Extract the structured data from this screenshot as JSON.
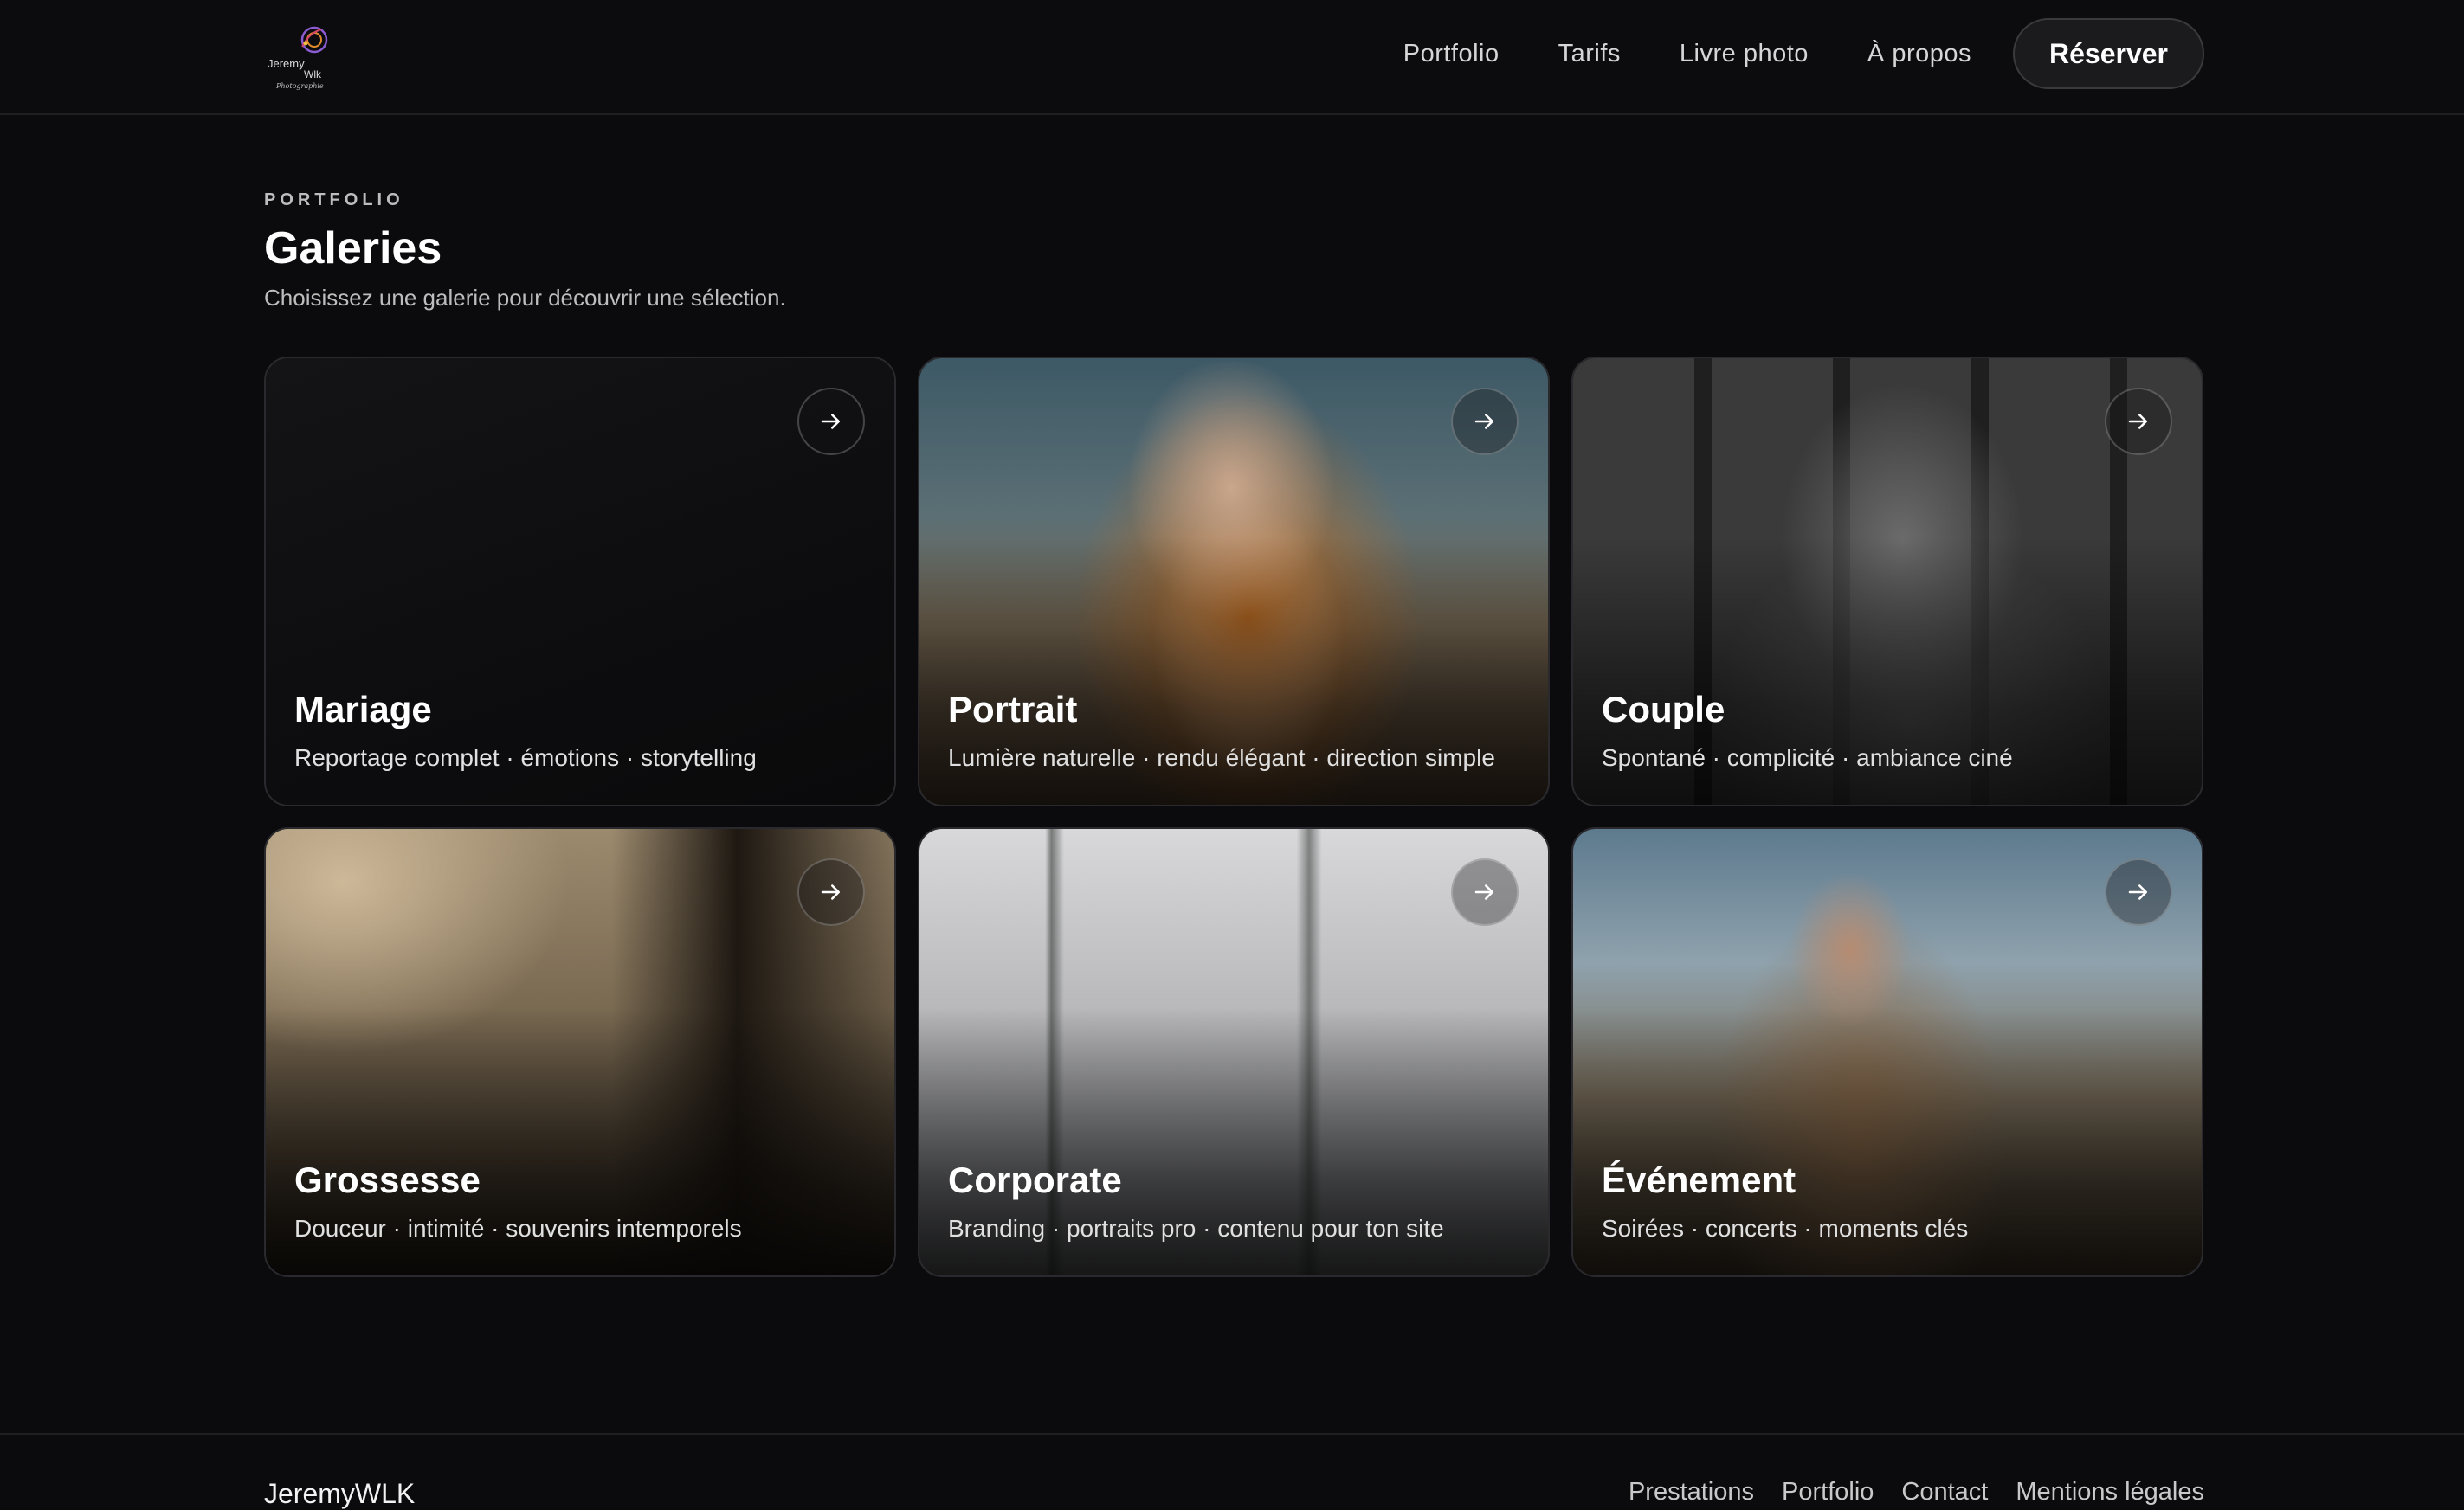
{
  "brand": {
    "logo_name": "JeremyWLK",
    "logo_lines": [
      "Jeremy",
      "Wlk",
      "Photographie"
    ]
  },
  "nav": {
    "items": [
      "Portfolio",
      "Tarifs",
      "Livre photo",
      "À propos"
    ],
    "cta": "Réserver"
  },
  "section": {
    "eyebrow": "PORTFOLIO",
    "title": "Galeries",
    "subtitle": "Choisissez une galerie pour découvrir une sélection."
  },
  "galleries": [
    {
      "title": "Mariage",
      "desc": "Reportage complet · émotions · storytelling"
    },
    {
      "title": "Portrait",
      "desc": "Lumière naturelle · rendu élégant · direction simple"
    },
    {
      "title": "Couple",
      "desc": "Spontané · complicité · ambiance ciné"
    },
    {
      "title": "Grossesse",
      "desc": "Douceur · intimité · souvenirs intemporels"
    },
    {
      "title": "Corporate",
      "desc": "Branding · portraits pro · contenu pour ton site"
    },
    {
      "title": "Événement",
      "desc": "Soirées · concerts · moments clés"
    }
  ],
  "footer": {
    "brand": "JeremyWLK",
    "links": [
      "Prestations",
      "Portfolio",
      "Contact",
      "Mentions légales"
    ]
  },
  "colors": {
    "background": "#0b0b0d",
    "card_border": "#2a2a2e",
    "text_primary": "#ffffff",
    "text_secondary": "#bdbdbd"
  }
}
